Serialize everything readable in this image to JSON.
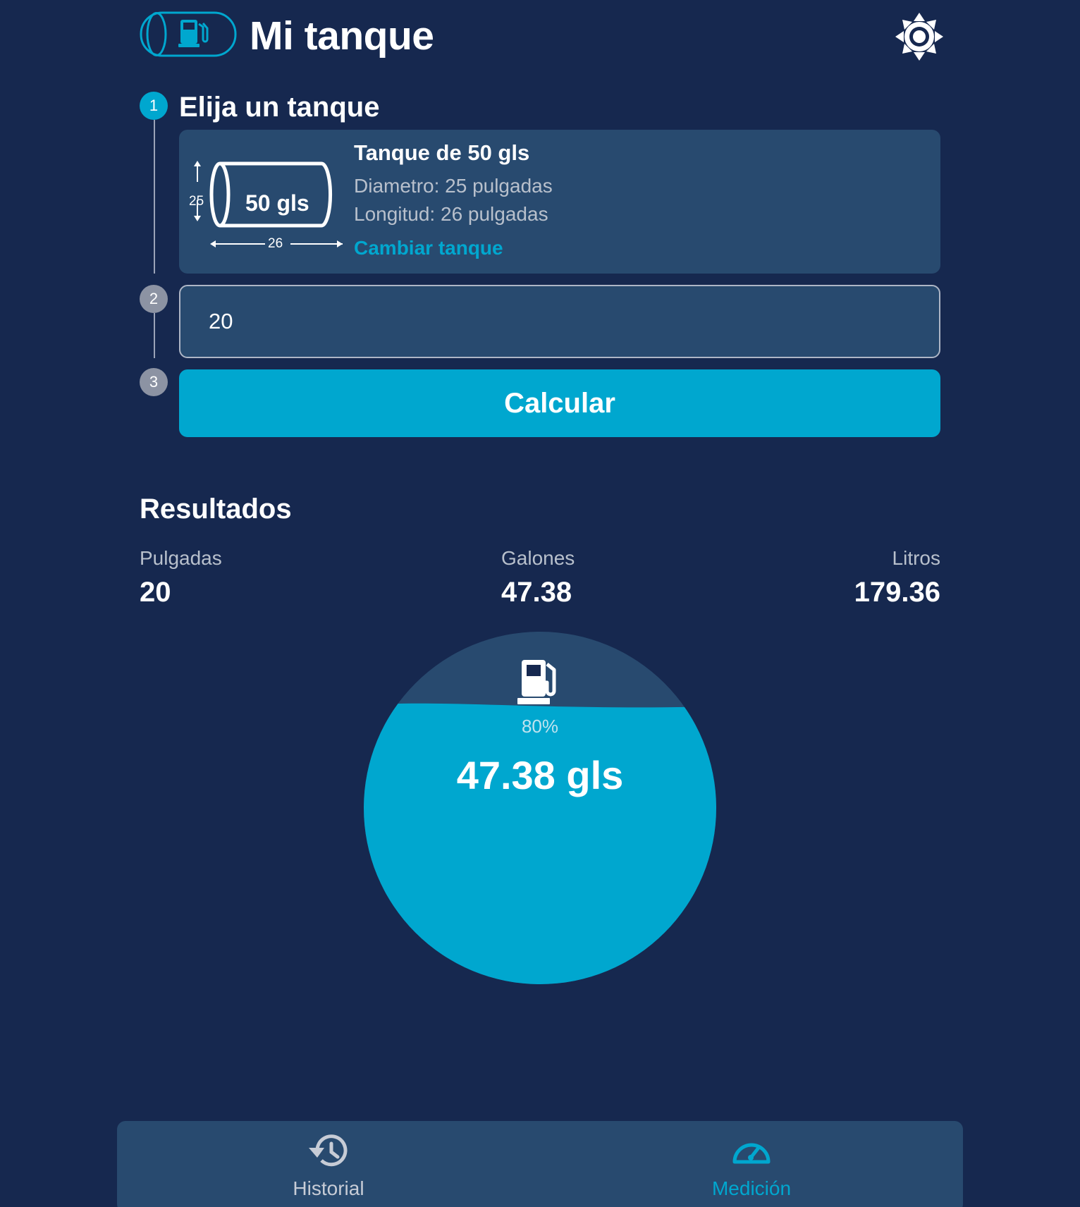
{
  "header": {
    "title": "Mi tanque",
    "logo_icon": "tank-fuel-logo-icon",
    "theme_icon": "sun-icon"
  },
  "steps": {
    "step1": {
      "number": "1",
      "title": "Elija un tanque",
      "tank": {
        "capacity_label": "50 gls",
        "diameter_dim": "25",
        "length_dim": "26",
        "name": "Tanque de 50 gls",
        "diameter": "Diametro: 25 pulgadas",
        "length": "Longitud: 26 pulgadas",
        "change_label": "Cambiar tanque"
      }
    },
    "step2": {
      "number": "2",
      "value": "20"
    },
    "step3": {
      "number": "3",
      "button_label": "Calcular"
    }
  },
  "results": {
    "title": "Resultados",
    "inches_label": "Pulgadas",
    "inches_value": "20",
    "gallons_label": "Galones",
    "gallons_value": "47.38",
    "liters_label": "Litros",
    "liters_value": "179.36"
  },
  "gauge": {
    "fill_fraction": 0.8,
    "percent_label": "80%",
    "volume_label": "47.38 gls",
    "icon": "fuel-pump-icon",
    "fill_color": "#00a7cf",
    "empty_color": "#284a6f"
  },
  "bottom_nav": {
    "items": [
      {
        "label": "Historial",
        "icon": "history-icon",
        "active": false
      },
      {
        "label": "Medición",
        "icon": "speedometer-icon",
        "active": true
      }
    ],
    "active_color": "#00a7cf",
    "inactive_color": "#c7ccd6"
  },
  "colors": {
    "background": "#16284f",
    "card": "#284a6f",
    "accent": "#00a7cf",
    "muted_text": "#b8c0cc"
  }
}
